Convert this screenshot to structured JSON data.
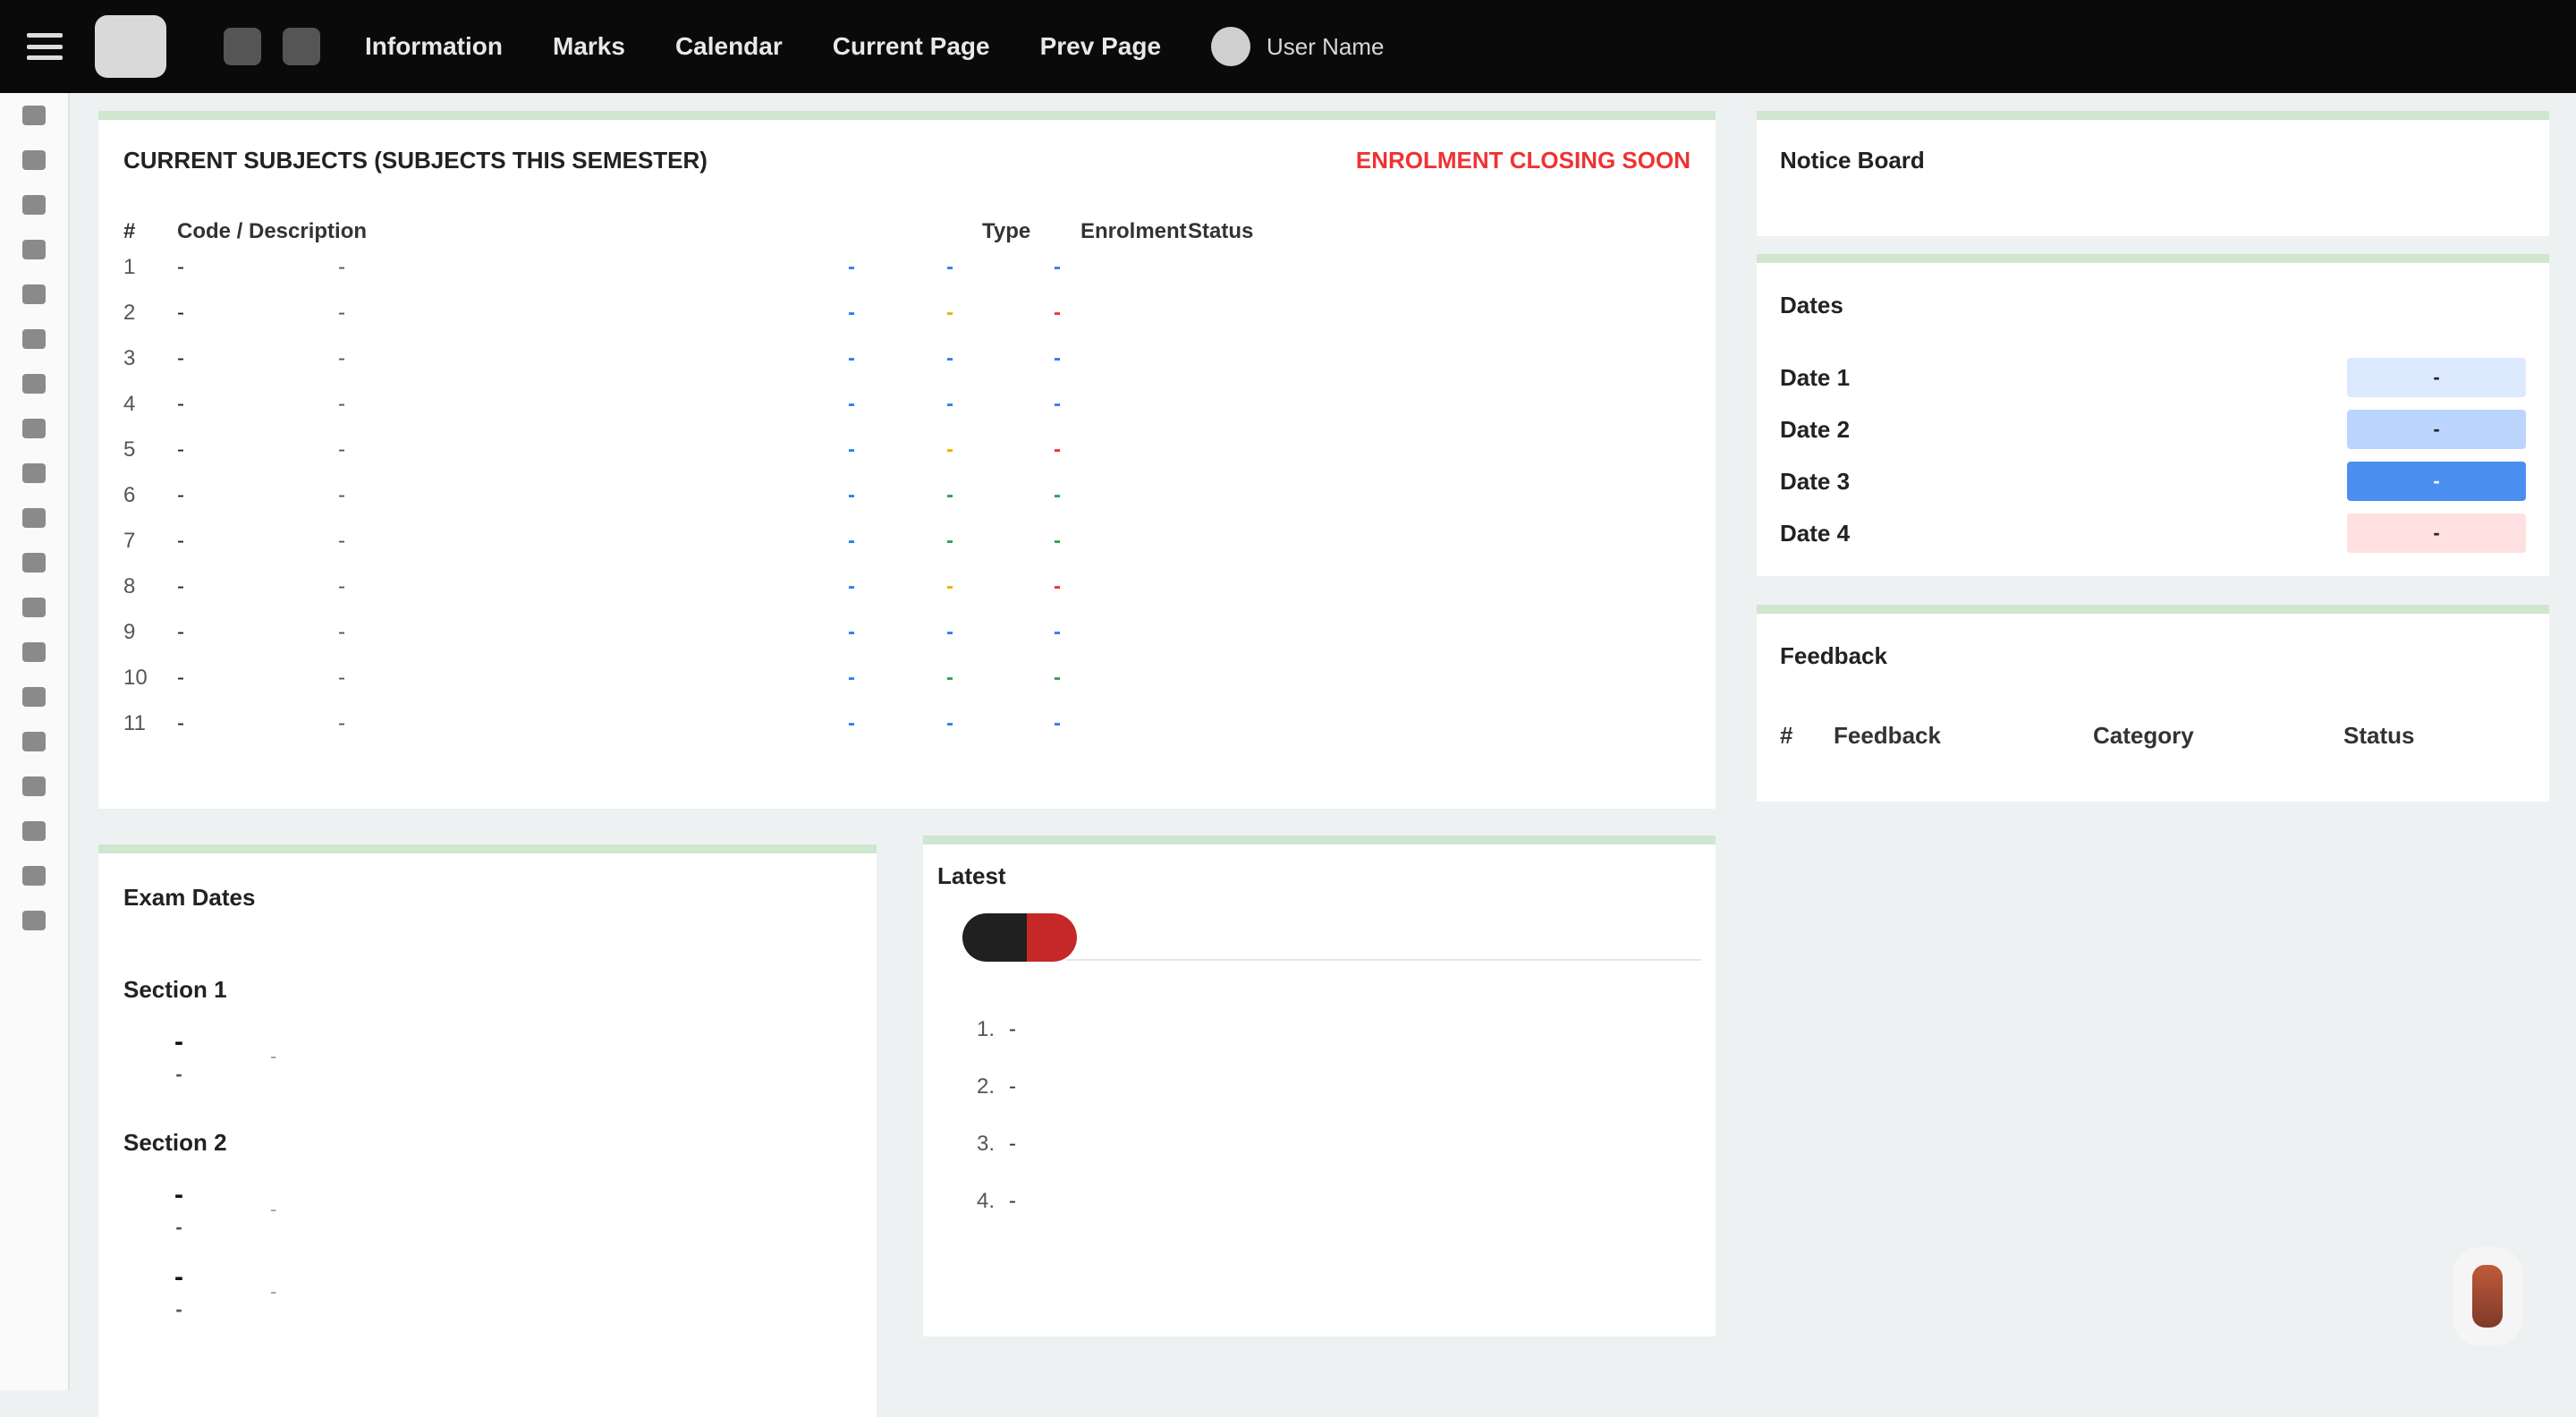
{
  "topbar": {
    "logo": {
      "mark": "",
      "line1": "",
      "line2": ""
    },
    "nav": [
      "Information",
      "Marks",
      "Calendar",
      "Current Page",
      "Prev Page"
    ],
    "user": {
      "name": "User Name"
    }
  },
  "subjects": {
    "title": "CURRENT SUBJECTS (SUBJECTS THIS SEMESTER)",
    "alert": "ENROLMENT CLOSING SOON",
    "headers": [
      "#",
      "Code / Description",
      "Type",
      "Enrolment",
      "Status"
    ],
    "rows": [
      {
        "n": "1",
        "code": "-",
        "desc": "-",
        "type": "-",
        "enrol": "-",
        "status": "-",
        "status_tone": "blue"
      },
      {
        "n": "2",
        "code": "-",
        "desc": "-",
        "type": "-",
        "enrol": "-",
        "status": "-",
        "status_tone": "red"
      },
      {
        "n": "3",
        "code": "-",
        "desc": "-",
        "type": "-",
        "enrol": "-",
        "status": "-",
        "status_tone": "blue"
      },
      {
        "n": "4",
        "code": "-",
        "desc": "-",
        "type": "-",
        "enrol": "-",
        "status": "-",
        "status_tone": "blue"
      },
      {
        "n": "5",
        "code": "-",
        "desc": "-",
        "type": "-",
        "enrol": "-",
        "status": "-",
        "status_tone": "red"
      },
      {
        "n": "6",
        "code": "-",
        "desc": "-",
        "type": "-",
        "enrol": "-",
        "status": "-",
        "status_tone": "green"
      },
      {
        "n": "7",
        "code": "-",
        "desc": "-",
        "type": "-",
        "enrol": "-",
        "status": "-",
        "status_tone": "green"
      },
      {
        "n": "8",
        "code": "-",
        "desc": "-",
        "type": "-",
        "enrol": "-",
        "status": "-",
        "status_tone": "red"
      },
      {
        "n": "9",
        "code": "-",
        "desc": "-",
        "type": "-",
        "enrol": "-",
        "status": "-",
        "status_tone": "blue"
      },
      {
        "n": "10",
        "code": "-",
        "desc": "-",
        "type": "-",
        "enrol": "-",
        "status": "-",
        "status_tone": "green"
      },
      {
        "n": "11",
        "code": "-",
        "desc": "-",
        "type": "-",
        "enrol": "-",
        "status": "-",
        "status_tone": "blue"
      }
    ]
  },
  "notice": {
    "title": "Notice Board"
  },
  "dates": {
    "title": "Dates",
    "rows": [
      {
        "label": "Date 1",
        "value": "-"
      },
      {
        "label": "Date 2",
        "value": "-"
      },
      {
        "label": "Date 3",
        "value": "-"
      },
      {
        "label": "Date 4",
        "value": "-"
      }
    ],
    "colors": {
      "blue_light": "#dce9ff",
      "blue_strong": "#4a8ff0",
      "red_light": "#ffe0e0"
    }
  },
  "feedback": {
    "title": "Feedback",
    "headers": [
      "#",
      "Feedback",
      "Category",
      "Status"
    ]
  },
  "exam": {
    "title": "Exam Dates",
    "sub1": "Section 1",
    "sub2": "Section 2",
    "items": [
      {
        "day": "-",
        "month": "-",
        "note": "-"
      },
      {
        "day": "-",
        "month": "-",
        "note": "-"
      },
      {
        "day": "-",
        "month": "-",
        "note": "-"
      }
    ]
  },
  "latest": {
    "title": "Latest",
    "items": [
      "-",
      "-",
      "-",
      "-"
    ]
  }
}
